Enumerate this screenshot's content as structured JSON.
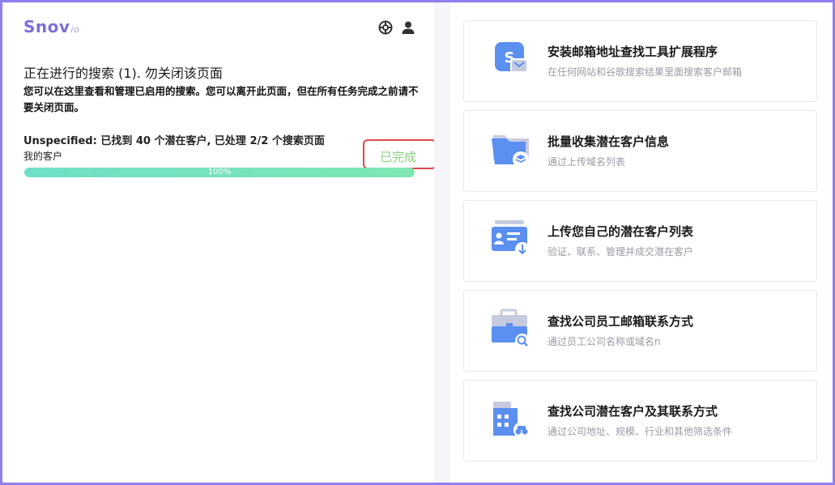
{
  "brand": {
    "name": "Snov",
    "suffix": "io",
    "color": "#7d6fd8"
  },
  "header_icons": [
    "support-lifebuoy-icon",
    "user-icon"
  ],
  "searches": {
    "title": "正在进行的搜索 (1). 勿关闭该页面",
    "description": "您可以在这里查看和管理已启用的搜索。您可以离开此页面，但在所有任务完成之前请不要关闭页面。",
    "task": {
      "summary": "Unspecified: 已找到 40 个潜在客户, 已处理 2/2 个搜索页面",
      "list_name": "我的客户",
      "status": "已完成",
      "progress_label": "100%",
      "progress_value": 100
    }
  },
  "tools": [
    {
      "icon": "extension-envelope-icon",
      "title": "安装邮箱地址查找工具扩展程序",
      "subtitle": "在任何网站和谷歌搜索结果里面搜索客户邮箱"
    },
    {
      "icon": "folder-layers-icon",
      "title": "批量收集潜在客户信息",
      "subtitle": "通过上传域名列表"
    },
    {
      "icon": "contact-card-upload-icon",
      "title": "上传您自己的潜在客户列表",
      "subtitle": "验证、联系、管理并成交潜在客户"
    },
    {
      "icon": "briefcase-search-icon",
      "title": "查找公司员工邮箱联系方式",
      "subtitle": "通过员工公司名称或域名n"
    },
    {
      "icon": "building-binoculars-icon",
      "title": "查找公司潜在客户及其联系方式",
      "subtitle": "通过公司地址、规模、行业和其他筛选条件"
    }
  ],
  "colors": {
    "frame_border": "#8f7ff0",
    "done_text": "#8bd07a",
    "highlight_border": "#e0474c",
    "icon_primary": "#5b8ff0",
    "icon_secondary": "#c7cbe0"
  }
}
